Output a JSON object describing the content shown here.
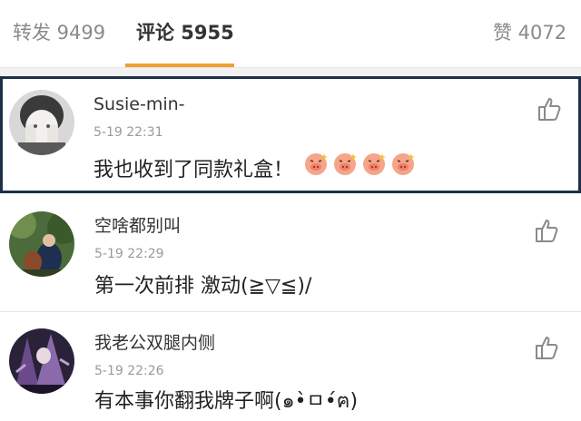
{
  "tabs": {
    "reposts": "转发 9499",
    "comments": "评论 5955",
    "likes": "赞 4072"
  },
  "comments": [
    {
      "username": "Susie-min-",
      "time": "5-19 22:31",
      "text": "我也收到了同款礼盒！",
      "emoji_count": 4,
      "highlighted": true
    },
    {
      "username": "空啥都别叫",
      "time": "5-19 22:29",
      "text": "第一次前排 激动(≧▽≦)/"
    },
    {
      "username": "我老公双腿内侧",
      "time": "5-19 22:26",
      "text": "有本事你翻我牌子啊(๑•̀ㅁ•́ฅ)"
    }
  ],
  "colors": {
    "accent_underline": "#f0a030",
    "highlight_border": "#1e2f4a"
  }
}
